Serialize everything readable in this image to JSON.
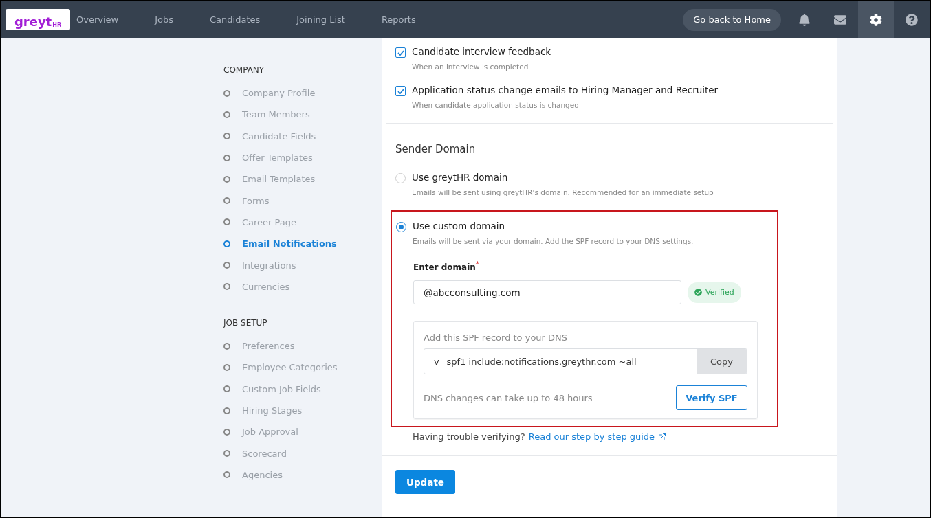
{
  "logo": {
    "text": "greyt",
    "subtext": "HR"
  },
  "nav": [
    {
      "label": "Overview",
      "selected": false
    },
    {
      "label": "Jobs",
      "selected": false
    },
    {
      "label": "Candidates",
      "selected": false
    },
    {
      "label": "Joining List",
      "selected": false
    },
    {
      "label": "Reports",
      "selected": false
    }
  ],
  "home_button": "Go back to Home",
  "nav_icons": [
    {
      "kind": "bell",
      "selected": false
    },
    {
      "kind": "mail",
      "selected": false
    },
    {
      "kind": "settings",
      "selected": true
    },
    {
      "kind": "help",
      "selected": false
    }
  ],
  "sidebar": [
    {
      "heading": "COMPANY",
      "items": [
        {
          "label": "Company Profile",
          "selected": false
        },
        {
          "label": "Team Members",
          "selected": false
        },
        {
          "label": "Candidate Fields",
          "selected": false
        },
        {
          "label": "Offer Templates",
          "selected": false
        },
        {
          "label": "Email Templates",
          "selected": false
        },
        {
          "label": "Forms",
          "selected": false
        },
        {
          "label": "Career Page",
          "selected": false
        },
        {
          "label": "Email Notifications",
          "selected": true
        },
        {
          "label": "Integrations",
          "selected": false
        },
        {
          "label": "Currencies",
          "selected": false
        }
      ]
    },
    {
      "heading": "JOB SETUP",
      "items": [
        {
          "label": "Preferences",
          "selected": false
        },
        {
          "label": "Employee Categories",
          "selected": false
        },
        {
          "label": "Custom Job Fields",
          "selected": false
        },
        {
          "label": "Hiring Stages",
          "selected": false
        },
        {
          "label": "Job Approval",
          "selected": false
        },
        {
          "label": "Scorecard",
          "selected": false
        },
        {
          "label": "Agencies",
          "selected": false
        }
      ]
    }
  ],
  "notifications": [
    {
      "label": "Candidate interview feedback",
      "description": "When an interview is completed",
      "checked": true
    },
    {
      "label": "Application status change emails to Hiring Manager and Recruiter",
      "description": "When candidate application status is changed",
      "checked": true
    }
  ],
  "sender_domain": {
    "title": "Sender Domain",
    "options": [
      {
        "label": "Use greytHR domain",
        "description": "Emails will be sent using greytHR's domain. Recommended for an immediate setup",
        "selected": false
      },
      {
        "label": "Use custom domain",
        "description": "Emails will be sent via your domain. Add the SPF record to your DNS settings.",
        "selected": true
      }
    ],
    "domain_label": "Enter domain",
    "required_mark": "*",
    "domain_value": "@abcconsulting.com",
    "status": "Verified",
    "spf_title": "Add this SPF record to your DNS",
    "spf_record": "v=spf1 include:notifications.greythr.com ~all",
    "copy_button": "Copy",
    "dns_note": "DNS changes can take up to 48 hours",
    "verify_button": "Verify SPF",
    "help_text": "Having trouble verifying?",
    "help_link": "Read our step by step guide"
  },
  "update_button": "Update"
}
